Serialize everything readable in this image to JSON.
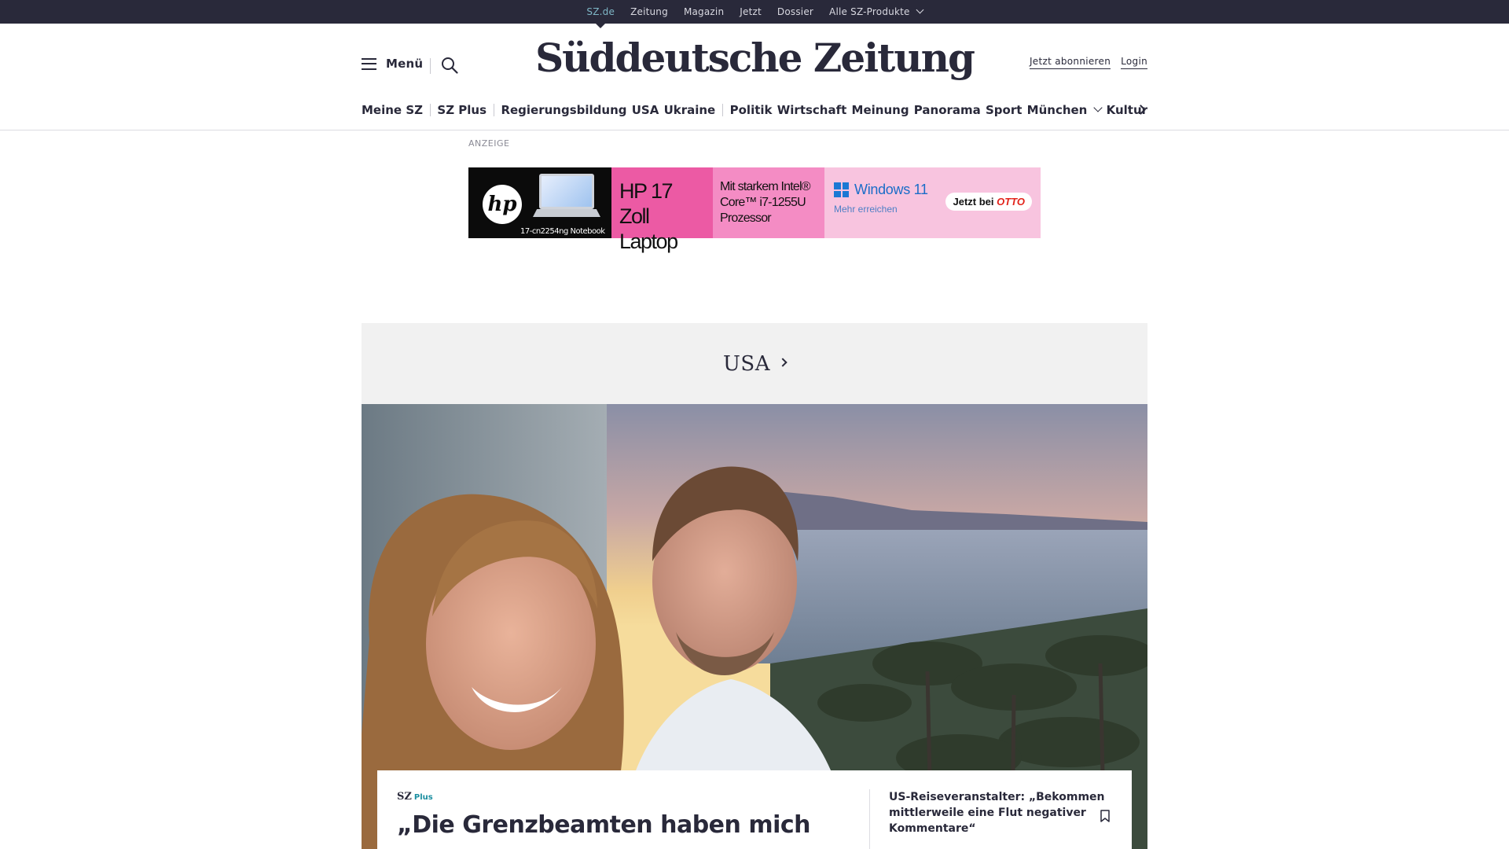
{
  "topbar": {
    "links": [
      "SZ.de",
      "Zeitung",
      "Magazin",
      "Jetzt",
      "Dossier",
      "Alle SZ-Produkte"
    ]
  },
  "header": {
    "menu_label": "Menü",
    "logo": "Süddeutsche Zeitung",
    "subscribe": "Jetzt abonnieren",
    "login": "Login"
  },
  "nav": {
    "items": [
      "Meine SZ",
      "SZ Plus",
      "Regierungsbildung",
      "USA",
      "Ukraine",
      "Politik",
      "Wirtschaft",
      "Meinung",
      "Panorama",
      "Sport",
      "München",
      "Kultur"
    ]
  },
  "ad": {
    "label": "ANZEIGE",
    "hp_logo": "hp",
    "model": "17-cn2254ng Notebook",
    "headline": "HP 17 Zoll Laptop",
    "cpu": "Mit starkem Intel® Core™ i7-1255U Prozessor",
    "windows": "Windows 11",
    "windows_sub": "Mehr erreichen",
    "cta_prefix": "Jetzt bei",
    "cta_brand": "OTTO"
  },
  "section": {
    "title": "USA"
  },
  "teaser": {
    "badge": "SZ",
    "badge_plus": "Plus",
    "headline": "„Die Grenzbeamten haben mich",
    "side_headline": "US-Reiseveranstalter: „Bekommen mittlerweile eine Flut negativer Kommentare“"
  },
  "colors": {
    "topbar_bg": "#29293a",
    "text": "#29293a",
    "accent": "#7eb6c6",
    "section_bg": "#f1f1f1"
  },
  "icons": {
    "menu": "hamburger-icon",
    "search": "search-icon",
    "dropdown": "chevron-down-icon",
    "scroll": "chevron-right-icon",
    "bookmark": "bookmark-icon"
  }
}
